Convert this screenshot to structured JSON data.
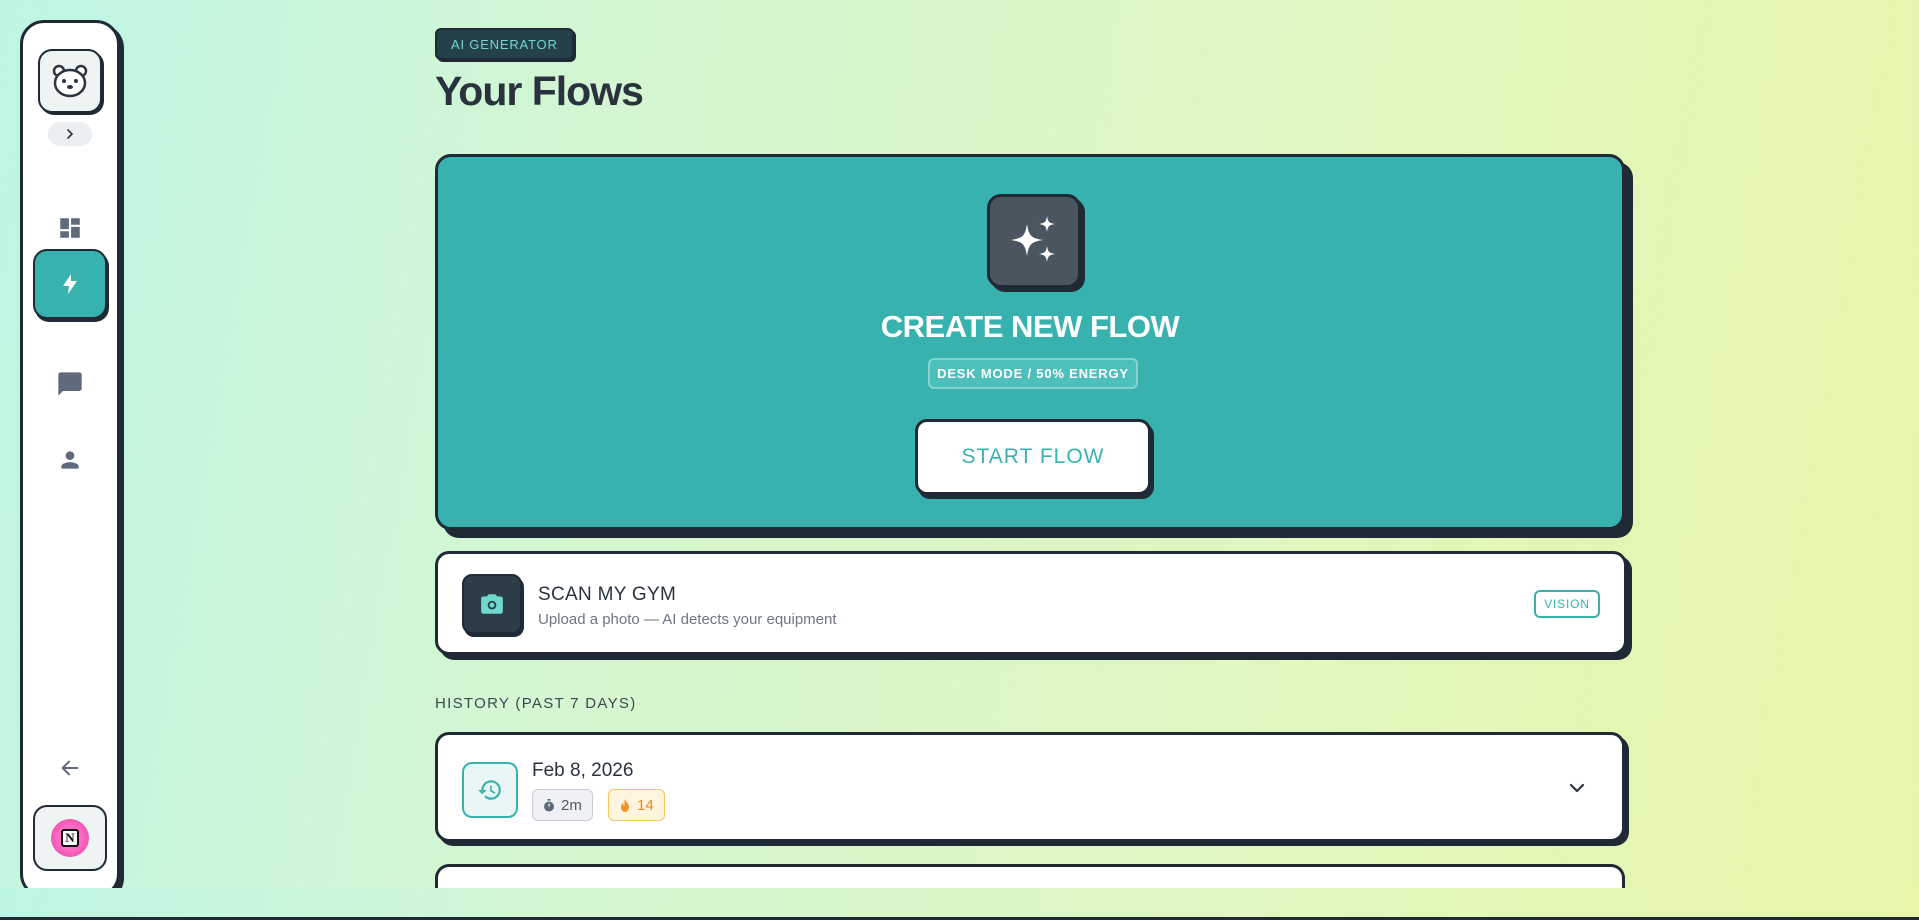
{
  "sidebar": {
    "logo_icon": "bear-face-icon",
    "expand_icon": "chevron-right-icon",
    "nav": [
      {
        "name": "dashboard",
        "icon": "dashboard-icon",
        "active": false
      },
      {
        "name": "flows",
        "icon": "lightning-icon",
        "active": true
      },
      {
        "name": "chat",
        "icon": "chat-icon",
        "active": false
      },
      {
        "name": "profile",
        "icon": "person-icon",
        "active": false
      }
    ],
    "back_icon": "arrow-left-icon",
    "avatar_letter": "N"
  },
  "header": {
    "tag": "AI GENERATOR",
    "title": "Your Flows"
  },
  "hero": {
    "icon": "sparkles-icon",
    "title": "CREATE NEW FLOW",
    "badge": "DESK MODE / 50% ENERGY",
    "button_label": "START FLOW"
  },
  "scan": {
    "icon": "camera-icon",
    "title": "SCAN MY GYM",
    "subtitle": "Upload a photo — AI detects your equipment",
    "badge": "VISION"
  },
  "history": {
    "heading": "HISTORY (PAST 7 DAYS)",
    "items": [
      {
        "date": "Feb 8, 2026",
        "duration": "2m",
        "count": "14",
        "icon": "history-icon"
      }
    ]
  },
  "colors": {
    "accent": "#38b2ae",
    "dark": "#1f2a36",
    "fire": "#e6891e"
  }
}
